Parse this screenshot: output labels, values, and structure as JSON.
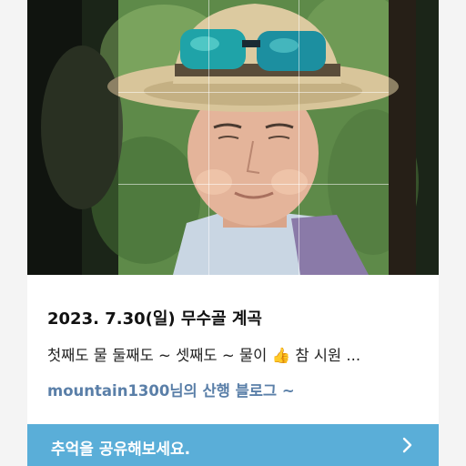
{
  "post": {
    "title": "2023. 7.30(일) 무수골 계곡",
    "description": "첫째도 물 둘째도 ~ 셋째도 ~ 물이 👍 참 시원 ...",
    "blog_name": "mountain1300님의 산행 블로그 ~"
  },
  "share": {
    "label": "추억을 공유해보세요.",
    "icon": "chevron-right-icon"
  },
  "photo": {
    "subject": "man wearing straw hat and blue sunglasses in forest",
    "crop_grid": true
  },
  "colors": {
    "share_bar": "#5aaed8",
    "blog_link": "#5a7fa8",
    "title_text": "#111111"
  }
}
